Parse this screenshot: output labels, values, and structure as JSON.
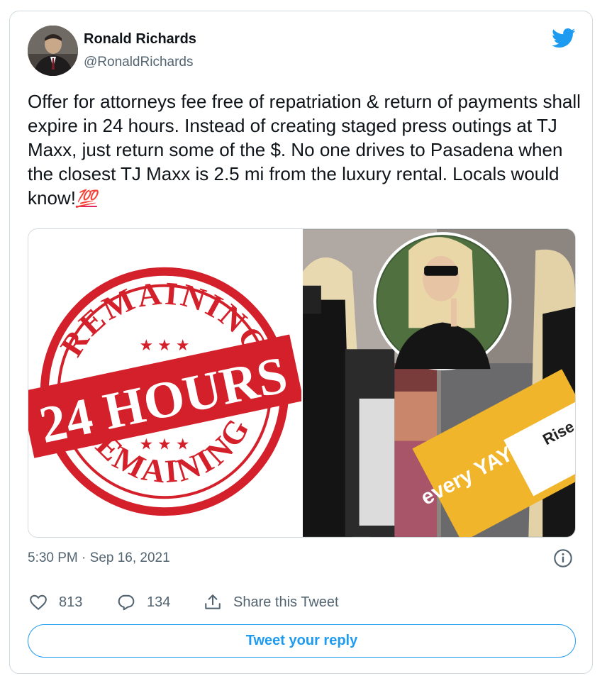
{
  "author": {
    "name": "Ronald Richards",
    "handle": "@RonaldRichards",
    "avatar_icon": "avatar-photo"
  },
  "brand": {
    "icon": "twitter-bird-icon",
    "color": "#1d9bf0"
  },
  "tweet": {
    "text": "Offer for attorneys fee free of repatriation & return of payments shall expire in 24 hours. Instead of creating staged press outings at TJ Maxx, just return some of the $. No one drives to Pasadena when the closest TJ Maxx is 2.5 mi from the luxury rental. Locals would know!",
    "emoji": "💯"
  },
  "media": {
    "stamp": {
      "top_word": "REMAINING",
      "main": "24 HOURS",
      "bottom_word": "REMAINING",
      "color": "#d4202a"
    },
    "box_brand": "every YAY",
    "box_text": "Rise"
  },
  "meta": {
    "timestamp": "5:30 PM · Sep 16, 2021"
  },
  "actions": {
    "likes": "813",
    "replies": "134",
    "share_label": "Share this Tweet"
  },
  "reply_button": "Tweet your reply",
  "colors": {
    "text": "#0f1419",
    "secondary": "#536471",
    "border": "#cfd9de",
    "accent": "#1d9bf0"
  }
}
